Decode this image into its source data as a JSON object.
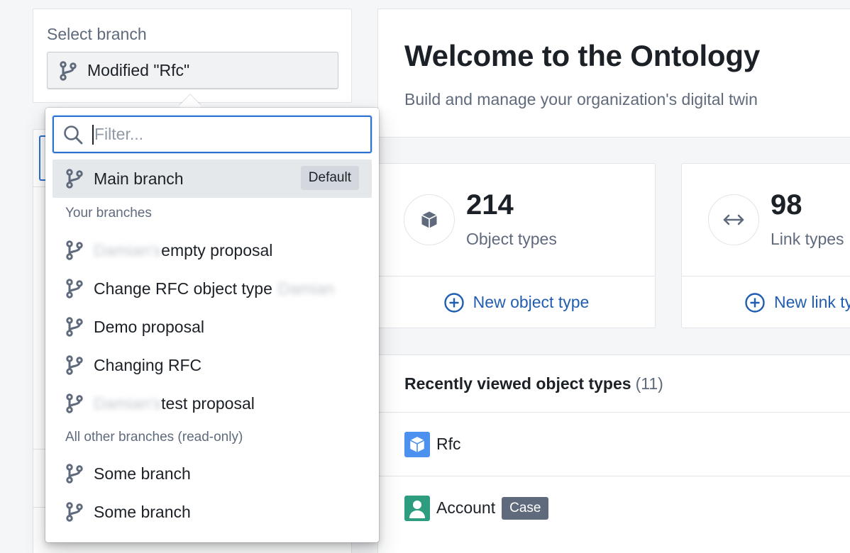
{
  "branch_selector": {
    "label": "Select branch",
    "selected": "Modified \"Rfc\""
  },
  "dropdown": {
    "filter_placeholder": "Filter...",
    "main_branch": {
      "label": "Main branch",
      "tag": "Default"
    },
    "your_branches_header": "Your branches",
    "your_branches": [
      {
        "prefix": "Damian's",
        "label": "empty proposal",
        "suffix": ""
      },
      {
        "prefix": "",
        "label": "Change RFC object type",
        "suffix": "Damian"
      },
      {
        "prefix": "",
        "label": "Demo proposal",
        "suffix": ""
      },
      {
        "prefix": "",
        "label": "Changing RFC",
        "suffix": ""
      },
      {
        "prefix": "Damian's",
        "label": "test proposal",
        "suffix": ""
      }
    ],
    "other_branches_header": "All other branches (read-only)",
    "other_branches": [
      {
        "label": "Some branch"
      },
      {
        "label": "Some branch"
      }
    ]
  },
  "welcome": {
    "title": "Welcome to the Ontology",
    "subtitle": "Build and manage your organization's digital twin"
  },
  "stats": [
    {
      "value": "214",
      "label": "Object types",
      "action": "New object type",
      "icon": "cube-icon"
    },
    {
      "value": "98",
      "label": "Link types",
      "action": "New link types",
      "icon": "arrows-horizontal-icon"
    }
  ],
  "recent": {
    "title": "Recently viewed object types",
    "count": "(11)",
    "items": [
      {
        "name": "Rfc",
        "tag": "",
        "icon": "cube-icon",
        "color": "#4c90f0"
      },
      {
        "name": "Account",
        "tag": "Case",
        "icon": "person-icon",
        "color": "#2d9c7f"
      }
    ]
  },
  "colors": {
    "accent": "#2d72d2",
    "link": "#215db0",
    "muted": "#5f6b7c"
  }
}
